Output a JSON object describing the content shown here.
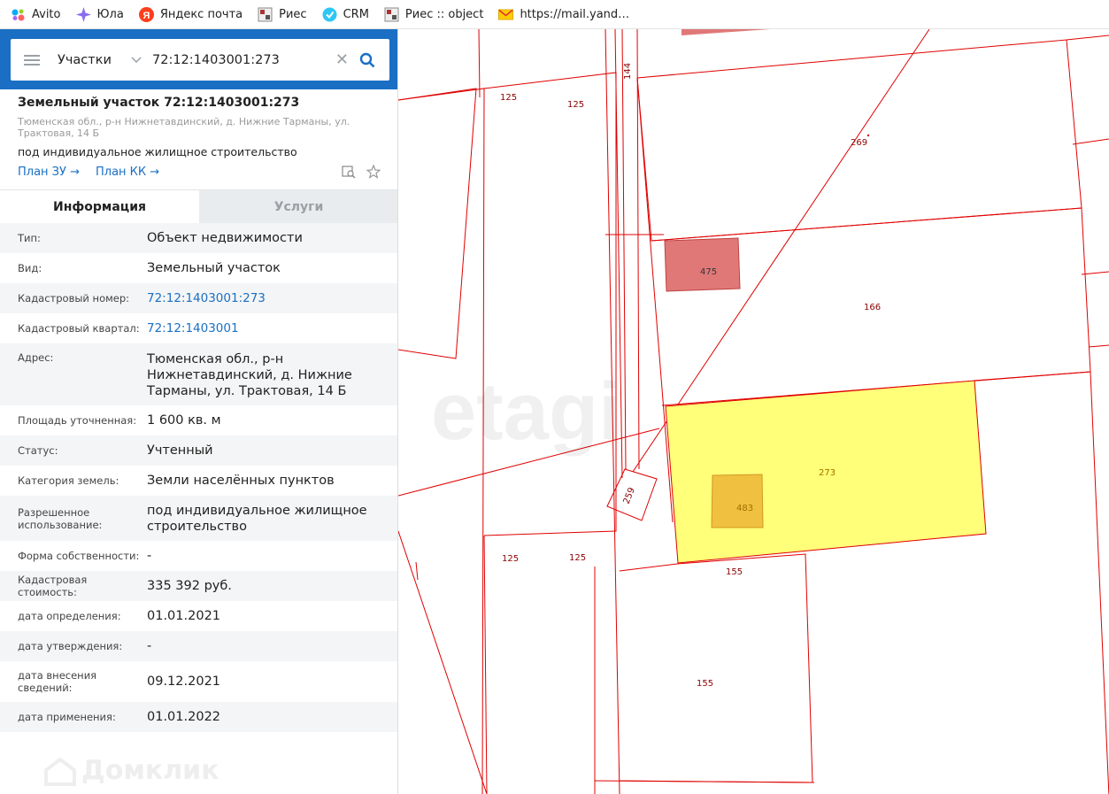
{
  "bookmarks": [
    {
      "label": "Avito",
      "icon": "avito-icon"
    },
    {
      "label": "Юла",
      "icon": "youla-icon"
    },
    {
      "label": "Яндекс почта",
      "icon": "yandex-icon"
    },
    {
      "label": "Риес",
      "icon": "ries-icon"
    },
    {
      "label": "CRM",
      "icon": "crm-icon"
    },
    {
      "label": "Риес :: object",
      "icon": "ries-icon"
    },
    {
      "label": "https://mail.yand…",
      "icon": "mail-icon"
    }
  ],
  "search": {
    "menu_icon": "hamburger-icon",
    "category": "Участки",
    "query": "72:12:1403001:273"
  },
  "object": {
    "title": "Земельный участок 72:12:1403001:273",
    "address_small": "Тюменская обл., р-н Нижнетавдинский, д. Нижние Тарманы, ул. Трактовая, 14 Б",
    "purpose": "под индивидуальное жилищное строительство",
    "plan_zu": "План ЗУ",
    "plan_kk": "План КК"
  },
  "tabs": {
    "info": "Информация",
    "services": "Услуги"
  },
  "rows": [
    {
      "label": "Тип:",
      "value": "Объект недвижимости"
    },
    {
      "label": "Вид:",
      "value": "Земельный участок"
    },
    {
      "label": "Кадастровый номер:",
      "value": "72:12:1403001:273",
      "link": true
    },
    {
      "label": "Кадастровый квартал:",
      "value": "72:12:1403001",
      "link": true
    },
    {
      "label": "Адрес:",
      "value": "Тюменская обл., р-н Нижнетавдинский, д. Нижние Тарманы, ул. Трактовая, 14 Б"
    },
    {
      "label": "Площадь уточненная:",
      "value": "1 600 кв. м"
    },
    {
      "label": "Статус:",
      "value": "Учтенный"
    },
    {
      "label": "Категория земель:",
      "value": "Земли населённых пунктов"
    },
    {
      "label": "Разрешенное использование:",
      "value": "под индивидуальное жилищное строительство"
    },
    {
      "label": "Форма собственности:",
      "value": "-"
    },
    {
      "label": "Кадастровая стоимость:",
      "value": "335 392 руб."
    },
    {
      "label": "дата определения:",
      "value": "01.01.2021"
    },
    {
      "label": "дата утверждения:",
      "value": "-"
    },
    {
      "label": "дата внесения сведений:",
      "value": "09.12.2021"
    },
    {
      "label": "дата применения:",
      "value": "01.01.2022"
    }
  ],
  "watermarks": {
    "panel": "Домклик",
    "map": "etagi"
  },
  "map_labels": {
    "p125a": "125",
    "p125b": "125",
    "p144": "144",
    "p269": "269",
    "p475": "475",
    "p166": "166",
    "p273": "273",
    "p483": "483",
    "p259": "259",
    "p125c": "125",
    "p125d": "125",
    "p155a": "155",
    "p155b": "155"
  },
  "colors": {
    "accent": "#1a6fc4",
    "boundary": "#e00000",
    "selected_parcel": "#ffff7a",
    "building": "#f0c040",
    "parcel_475": "#e07878"
  }
}
